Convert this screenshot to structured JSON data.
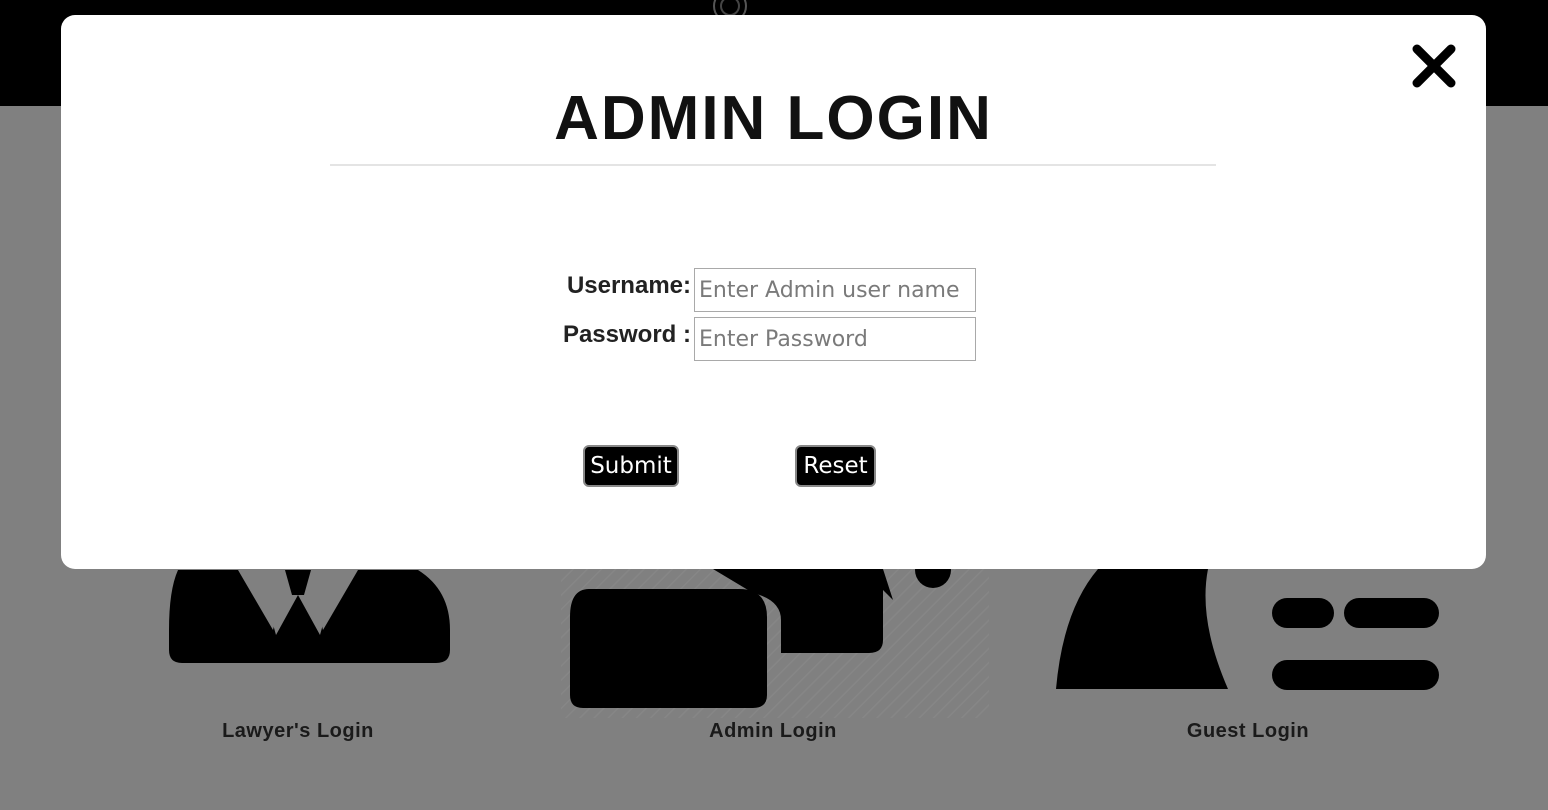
{
  "background": {
    "cards": [
      {
        "label": "Lawyer's Login",
        "icon": "lawyer-icon"
      },
      {
        "label": "Admin Login",
        "icon": "admin-icon"
      },
      {
        "label": "Guest Login",
        "icon": "guest-icon"
      }
    ]
  },
  "modal": {
    "title": "ADMIN LOGIN",
    "close_icon": "close-icon",
    "username_label": "Username:",
    "username_placeholder": "Enter Admin user name",
    "password_label": "Password :",
    "password_placeholder": "Enter Password",
    "submit_label": "Submit",
    "reset_label": "Reset"
  },
  "colors": {
    "overlay": "#808080",
    "modal_bg": "#ffffff",
    "button_bg": "#000000",
    "topbar": "#000000"
  }
}
